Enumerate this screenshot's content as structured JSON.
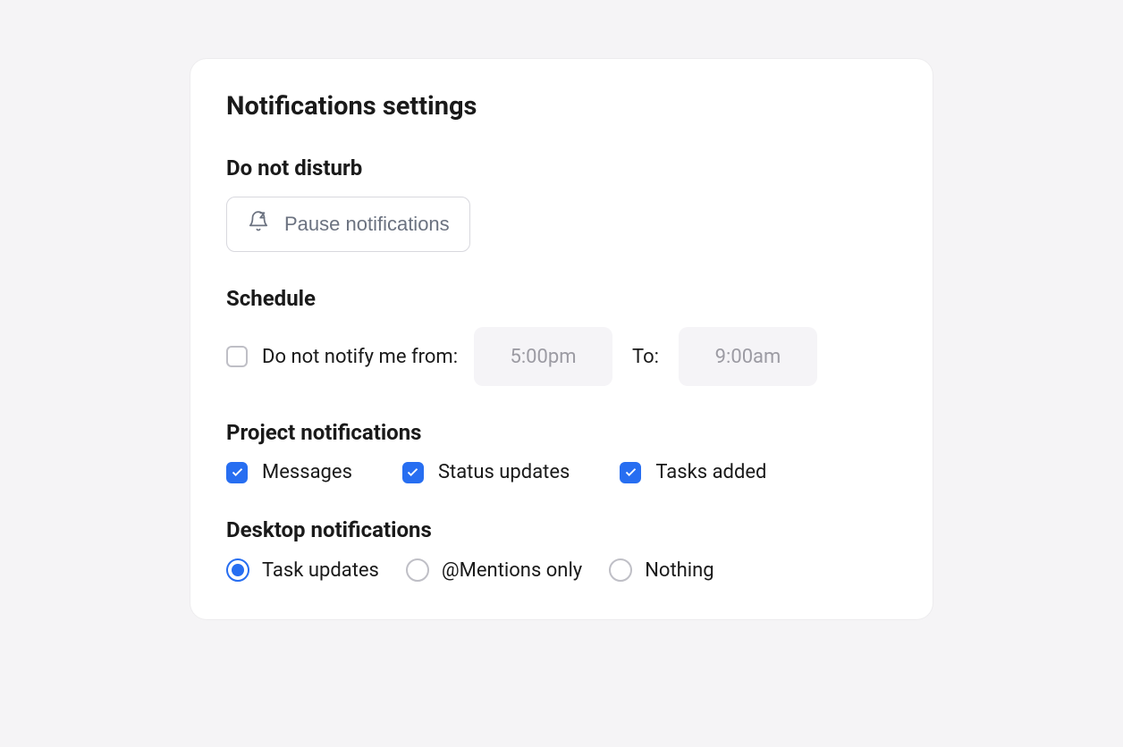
{
  "title": "Notifications settings",
  "dnd": {
    "heading": "Do not disturb",
    "pause_label": "Pause notifications"
  },
  "schedule": {
    "heading": "Schedule",
    "checkbox_label": "Do not notify me from:",
    "checked": false,
    "from_value": "5:00pm",
    "to_label": "To:",
    "to_value": "9:00am"
  },
  "project": {
    "heading": "Project notifications",
    "options": [
      {
        "label": "Messages",
        "checked": true
      },
      {
        "label": "Status updates",
        "checked": true
      },
      {
        "label": "Tasks added",
        "checked": true
      }
    ]
  },
  "desktop": {
    "heading": "Desktop notifications",
    "options": [
      {
        "label": "Task updates",
        "selected": true
      },
      {
        "label": "@Mentions only",
        "selected": false
      },
      {
        "label": "Nothing",
        "selected": false
      }
    ]
  }
}
